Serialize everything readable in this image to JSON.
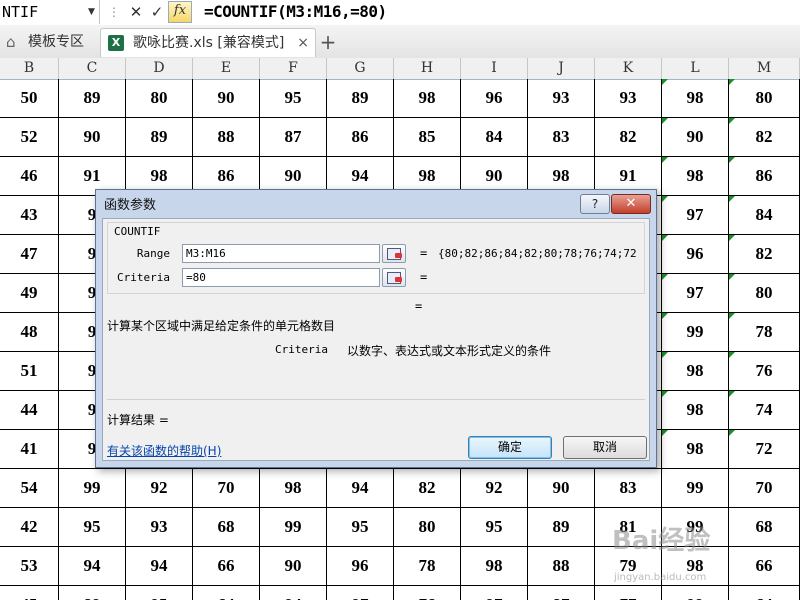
{
  "formula_bar": {
    "name_box": "NTIF",
    "formula": "=COUNTIF(M3:M16,=80)"
  },
  "tabs": {
    "home_label": "模板专区",
    "file_label": "歌咏比赛.xls  [兼容模式]",
    "close_icon": "×",
    "add_icon": "+"
  },
  "columns": [
    "B",
    "C",
    "D",
    "E",
    "F",
    "G",
    "H",
    "I",
    "J",
    "K",
    "L",
    "M"
  ],
  "rows": [
    [
      "50",
      "89",
      "80",
      "90",
      "95",
      "89",
      "98",
      "96",
      "93",
      "93",
      "98",
      "80"
    ],
    [
      "52",
      "90",
      "89",
      "88",
      "87",
      "86",
      "85",
      "84",
      "83",
      "82",
      "90",
      "82"
    ],
    [
      "46",
      "91",
      "98",
      "86",
      "90",
      "94",
      "98",
      "90",
      "98",
      "91",
      "98",
      "86"
    ],
    [
      "43",
      "9",
      "",
      "",
      "",
      "",
      "",
      "",
      "",
      "",
      "97",
      "84"
    ],
    [
      "47",
      "9",
      "",
      "",
      "",
      "",
      "",
      "",
      "",
      "",
      "96",
      "82"
    ],
    [
      "49",
      "9",
      "",
      "",
      "",
      "",
      "",
      "",
      "",
      "",
      "97",
      "80"
    ],
    [
      "48",
      "9",
      "",
      "",
      "",
      "",
      "",
      "",
      "",
      "",
      "99",
      "78"
    ],
    [
      "51",
      "9",
      "",
      "",
      "",
      "",
      "",
      "",
      "",
      "",
      "98",
      "76"
    ],
    [
      "44",
      "9",
      "",
      "",
      "",
      "",
      "",
      "",
      "",
      "",
      "98",
      "74"
    ],
    [
      "41",
      "9",
      "",
      "",
      "",
      "",
      "",
      "",
      "",
      "",
      "98",
      "72"
    ],
    [
      "54",
      "99",
      "92",
      "70",
      "98",
      "94",
      "82",
      "92",
      "90",
      "83",
      "99",
      "70"
    ],
    [
      "42",
      "95",
      "93",
      "68",
      "99",
      "95",
      "80",
      "95",
      "89",
      "81",
      "99",
      "68"
    ],
    [
      "53",
      "94",
      "94",
      "66",
      "90",
      "96",
      "78",
      "98",
      "88",
      "79",
      "98",
      "66"
    ],
    [
      "45",
      "89",
      "95",
      "64",
      "94",
      "97",
      "76",
      "97",
      "87",
      "77",
      "99",
      "64"
    ]
  ],
  "dialog": {
    "title": "函数参数",
    "help_button": "?",
    "close_button": "✕",
    "function_name": "COUNTIF",
    "args": [
      {
        "label": "Range",
        "value": "M3:M16",
        "result": "{80;82;86;84;82;80;78;76;74;72"
      },
      {
        "label": "Criteria",
        "value": "=80",
        "result": ""
      }
    ],
    "equals": "=",
    "description": "计算某个区域中满足给定条件的单元格数目",
    "arg_desc_name": "Criteria",
    "arg_desc_text": "以数字、表达式或文本形式定义的条件",
    "calc_result_label": "计算结果 =",
    "help_link": "有关该函数的帮助(H)",
    "ok_label": "确定",
    "cancel_label": "取消"
  },
  "watermark": {
    "logo_text": "Bai经验",
    "sub_text": "jingyan.baidu.com"
  }
}
